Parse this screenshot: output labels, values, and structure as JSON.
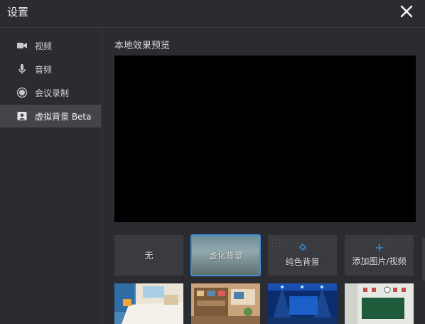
{
  "window": {
    "title": "设置"
  },
  "sidebar": {
    "items": [
      {
        "label": "视频",
        "icon": "video-camera-icon"
      },
      {
        "label": "音频",
        "icon": "microphone-icon"
      },
      {
        "label": "会议录制",
        "icon": "record-icon"
      },
      {
        "label": "虚拟背景 Beta",
        "icon": "portrait-icon",
        "active": true
      }
    ]
  },
  "main": {
    "preview_title": "本地效果预览",
    "options": [
      {
        "label": "无"
      },
      {
        "label": "虚化背景",
        "selected": true
      },
      {
        "label": "纯色背景",
        "icon": "paint-bucket-icon"
      },
      {
        "label": "添加图片/视频",
        "icon": "plus-icon"
      }
    ],
    "thumbnails": [
      {
        "name": "bedroom"
      },
      {
        "name": "living-room"
      },
      {
        "name": "stage"
      },
      {
        "name": "classroom"
      }
    ]
  },
  "colors": {
    "accent": "#3d8fd8",
    "panel": "#2b2c31",
    "active_item": "#43454b"
  }
}
